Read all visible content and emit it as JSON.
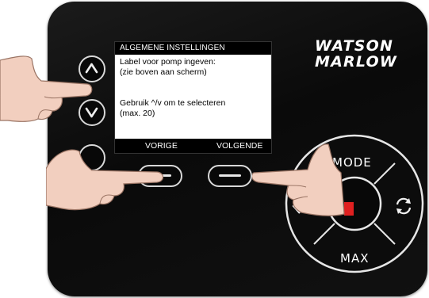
{
  "brand": {
    "line1": "WATSON",
    "line2": "MARLOW"
  },
  "screen": {
    "title": "ALGEMENE INSTELLINGEN",
    "lines": [
      "Label voor pomp ingeven:",
      "(zie boven aan scherm)",
      "Gebruik ^/v om te selecteren",
      "(max. 20)"
    ],
    "softkeys": {
      "left": "VORIGE",
      "right": "VOLGENDE"
    }
  },
  "buttons": {
    "mode": "MODE",
    "max": "MAX",
    "up_icon": "chevron-up-icon",
    "down_icon": "chevron-down-icon",
    "refresh_icon": "rotate-icon"
  },
  "colors": {
    "panel": "#111111",
    "run_indicator": "#e02020",
    "screen_bg": "#ffffff"
  }
}
